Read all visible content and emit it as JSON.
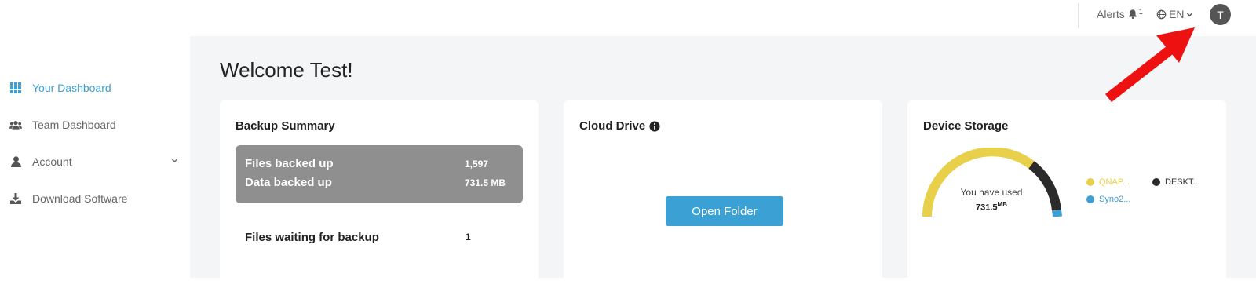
{
  "topbar": {
    "alerts_label": "Alerts",
    "alerts_count": "1",
    "language": "EN",
    "avatar_initial": "T"
  },
  "sidebar": {
    "items": [
      {
        "label": "Your Dashboard",
        "icon": "grid-icon",
        "active": true
      },
      {
        "label": "Team Dashboard",
        "icon": "users-icon",
        "active": false
      },
      {
        "label": "Account",
        "icon": "user-icon",
        "active": false,
        "has_dropdown": true
      },
      {
        "label": "Download Software",
        "icon": "download-icon",
        "active": false
      }
    ]
  },
  "main": {
    "welcome": "Welcome Test!",
    "backup_summary": {
      "title": "Backup Summary",
      "files_backed_up_label": "Files backed up",
      "files_backed_up_value": "1,597",
      "data_backed_up_label": "Data backed up",
      "data_backed_up_value": "731.5 MB",
      "files_waiting_label": "Files waiting for backup",
      "files_waiting_value": "1"
    },
    "cloud_drive": {
      "title": "Cloud Drive",
      "open_folder_label": "Open Folder"
    },
    "device_storage": {
      "title": "Device Storage",
      "used_label": "You have used",
      "used_value": "731.5",
      "used_unit": "MB",
      "legend": [
        {
          "label": "QNAP...",
          "color": "#e8d04a"
        },
        {
          "label": "DESKT...",
          "color": "#2b2b2b"
        },
        {
          "label": "Syno2...",
          "color": "#3ba0d3"
        }
      ]
    }
  },
  "colors": {
    "accent": "#3ba0d3",
    "summary_box": "#8f8f8f",
    "gauge_yellow": "#e8d04a",
    "gauge_dark": "#2b2b2b",
    "gauge_blue": "#3ba0d3"
  }
}
